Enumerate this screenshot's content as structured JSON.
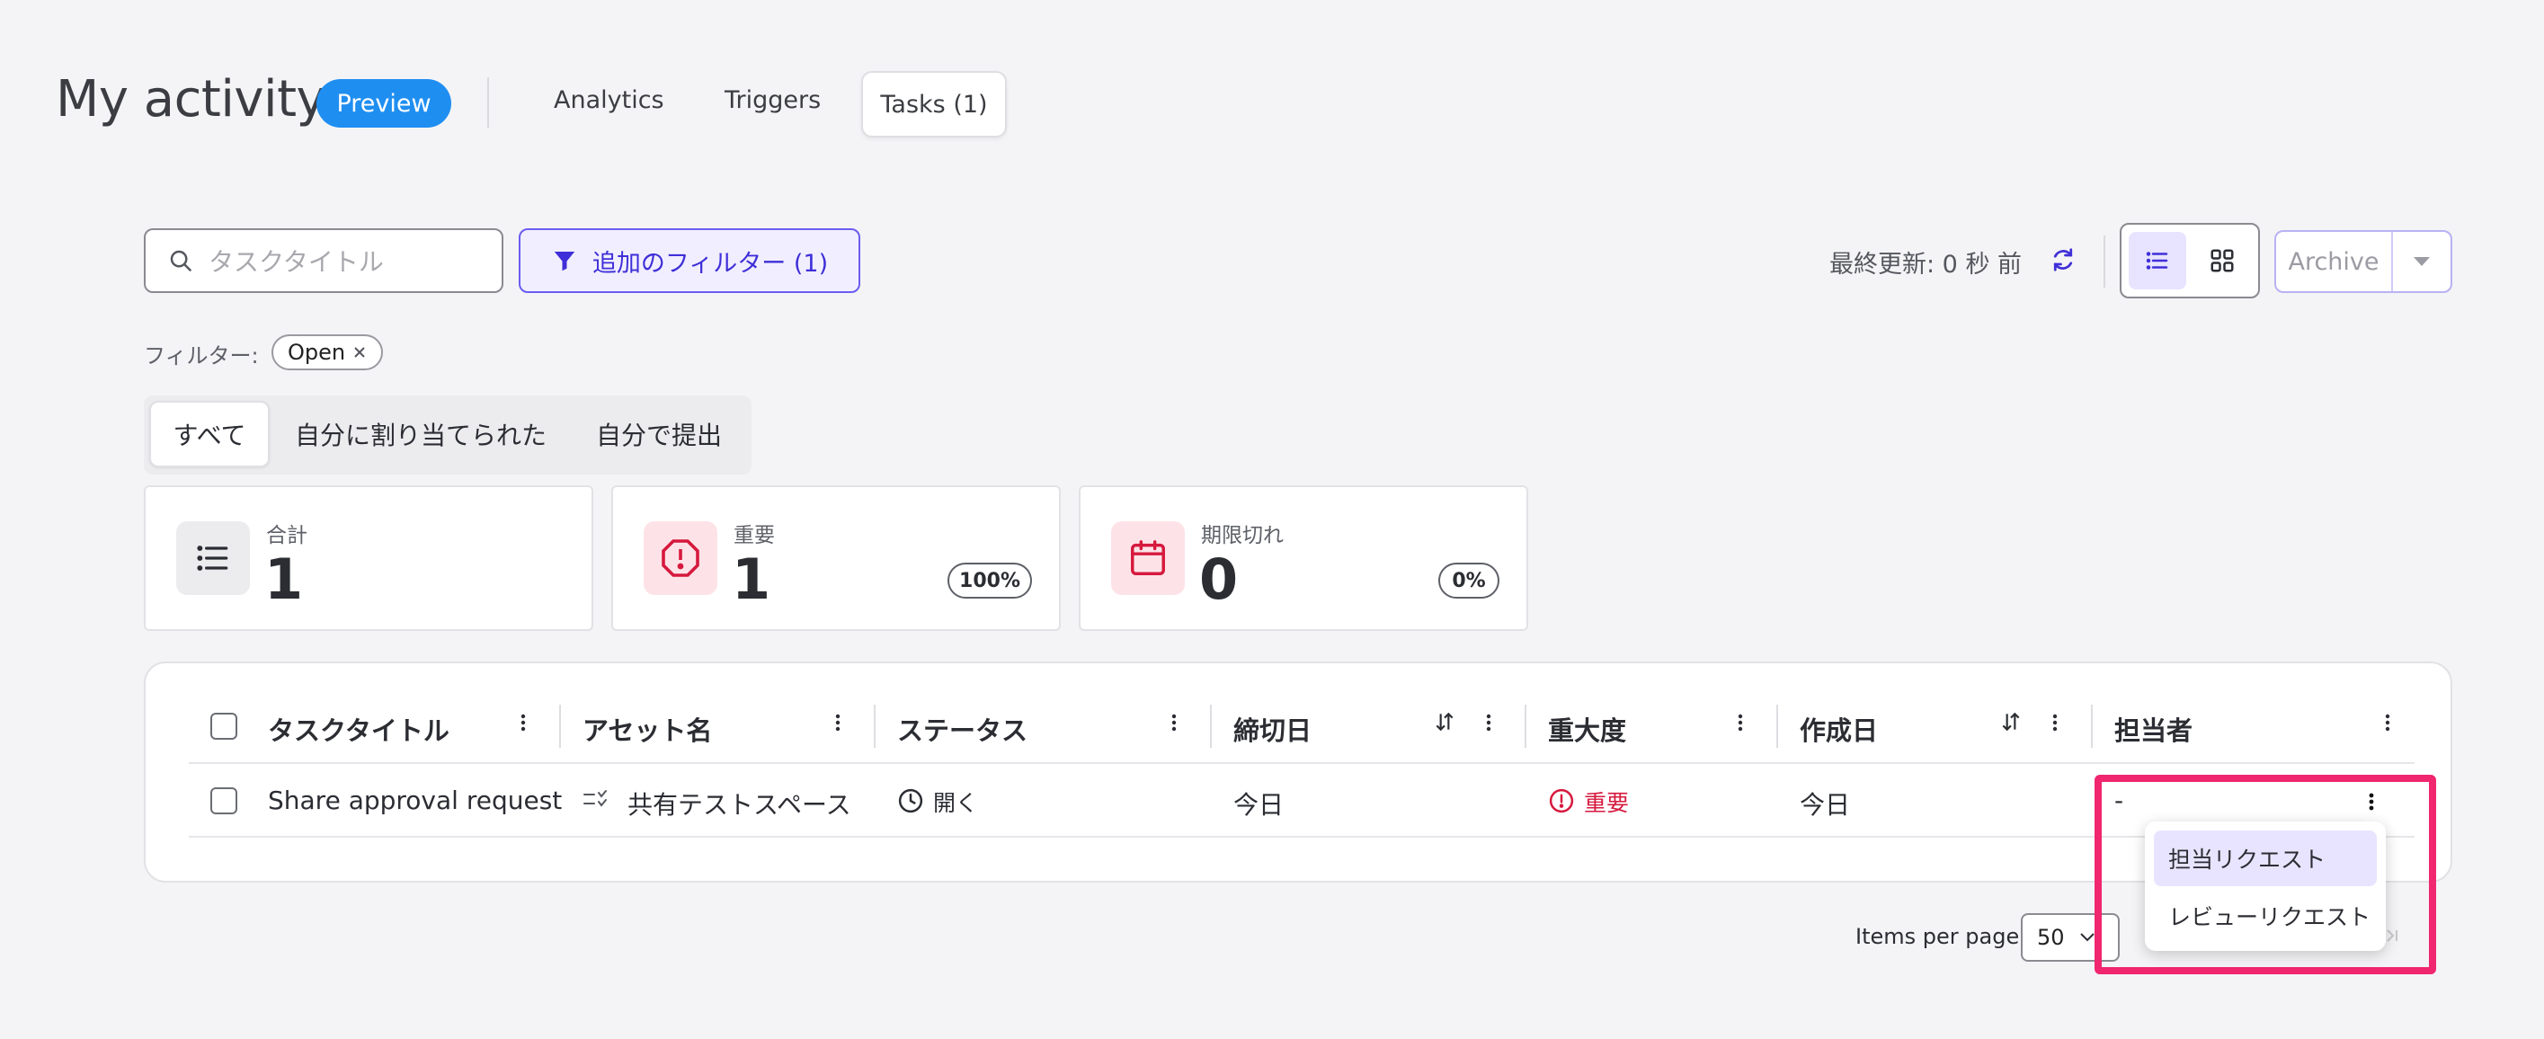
{
  "header": {
    "title": "My activity",
    "badge": "Preview",
    "tabs": [
      {
        "label": "Analytics"
      },
      {
        "label": "Triggers"
      },
      {
        "label": "Tasks (1)",
        "active": true
      }
    ]
  },
  "toolbar": {
    "search_placeholder": "タスクタイトル",
    "filter_button": "追加のフィルター (1)",
    "last_updated": "最終更新: 0 秒 前",
    "archive_label": "Archive",
    "view_mode": "list"
  },
  "filters": {
    "label": "フィルター:",
    "chips": [
      {
        "label": "Open"
      }
    ]
  },
  "segments": [
    {
      "label": "すべて",
      "active": true
    },
    {
      "label": "自分に割り当てられた"
    },
    {
      "label": "自分で提出"
    }
  ],
  "summary": [
    {
      "label": "合計",
      "value": "1",
      "icon": "list-icon"
    },
    {
      "label": "重要",
      "value": "1",
      "pill": "100%",
      "icon": "alert-octagon-icon"
    },
    {
      "label": "期限切れ",
      "value": "0",
      "pill": "0%",
      "icon": "calendar-icon"
    }
  ],
  "table": {
    "columns": [
      "タスクタイトル",
      "アセット名",
      "ステータス",
      "締切日",
      "重大度",
      "作成日",
      "担当者"
    ],
    "rows": [
      {
        "title": "Share approval request",
        "asset": "共有テストスペース",
        "status": "開く",
        "due": "今日",
        "severity": "重要",
        "created": "今日",
        "assignee": "-"
      }
    ]
  },
  "row_menu": {
    "items": [
      {
        "label": "担当リクエスト",
        "highlighted": true
      },
      {
        "label": "レビューリクエスト"
      }
    ]
  },
  "pagination": {
    "items_per_page_label": "Items per page",
    "items_per_page": "50"
  },
  "colors": {
    "accent": "#6b5cf0",
    "badge": "#1f8ef1",
    "danger": "#d6193e",
    "highlight": "#f0266f"
  }
}
